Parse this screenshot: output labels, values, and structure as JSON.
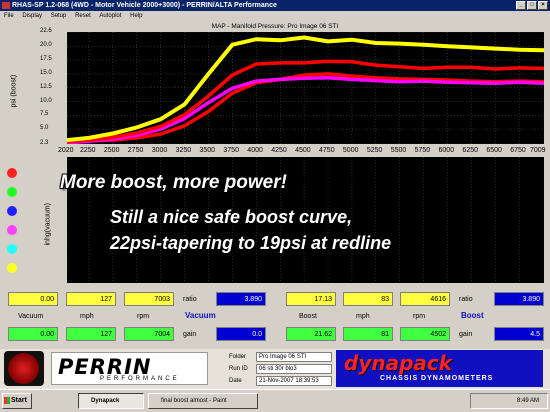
{
  "window": {
    "title": "RHAS-SP 1.2-068  (4WD - Motor Vehicle 2000+3000) - PERRIN/ALTA Performance"
  },
  "menu": [
    "File",
    "Display",
    "Setup",
    "Reset",
    "Autoplot",
    "Help"
  ],
  "chart_title": "MAP - Manifold Pressure: Pro Image 06 STI",
  "top_y_label": "psi (boost)",
  "top_y_ticks": [
    "22.6",
    "20.0",
    "17.5",
    "15.0",
    "12.5",
    "10.0",
    "7.5",
    "5.0",
    "2.3"
  ],
  "bottom_y_label": "inhg(vacuum)",
  "x_ticks": [
    "2020",
    "2250",
    "2500",
    "2750",
    "3000",
    "3250",
    "3500",
    "3750",
    "4000",
    "4250",
    "4500",
    "4750",
    "5000",
    "5250",
    "5500",
    "5750",
    "6000",
    "6250",
    "6500",
    "6750",
    "7009"
  ],
  "chart_data": {
    "type": "line",
    "title": "MAP - Manifold Pressure: Pro Image 06 STI",
    "xlabel": "",
    "ylabel": "psi (boost)",
    "xlim": [
      2020,
      7009
    ],
    "ylim": [
      2.3,
      22.6
    ],
    "x": [
      2020,
      2250,
      2500,
      2750,
      3000,
      3250,
      3500,
      3750,
      4000,
      4250,
      4500,
      4750,
      5000,
      5250,
      5500,
      5750,
      6000,
      6250,
      6500,
      6750,
      7009
    ],
    "series": [
      {
        "color": "#ffff00",
        "values": [
          3.0,
          3.4,
          4.2,
          5.3,
          6.8,
          9.5,
          15.0,
          20.3,
          21.3,
          21.1,
          21.6,
          20.9,
          21.2,
          20.6,
          20.5,
          20.3,
          20.0,
          19.8,
          19.6,
          19.4,
          19.3
        ]
      },
      {
        "color": "#ff0000",
        "values": [
          2.7,
          3.0,
          3.5,
          4.3,
          5.5,
          7.6,
          11.0,
          14.8,
          16.8,
          17.0,
          17.0,
          17.3,
          17.2,
          16.6,
          16.3,
          16.0,
          16.2,
          16.2,
          15.9,
          16.1,
          16.0
        ]
      },
      {
        "color": "#ff00ff",
        "values": [
          2.5,
          2.8,
          3.2,
          3.9,
          5.0,
          6.9,
          9.8,
          12.4,
          13.7,
          14.0,
          14.2,
          14.3,
          14.0,
          13.8,
          13.6,
          13.7,
          13.5,
          13.4,
          13.3,
          13.5,
          13.3
        ]
      },
      {
        "color": "#ff0000",
        "values": [
          2.8,
          2.9,
          3.0,
          3.4,
          4.1,
          5.6,
          8.2,
          11.5,
          13.4,
          14.0,
          14.8,
          15.0,
          14.6,
          14.3,
          14.1,
          14.0,
          13.9,
          13.7,
          13.6,
          13.7,
          13.6
        ]
      }
    ]
  },
  "legend_dots": [
    "#ff2020",
    "#20ff20",
    "#2020ff",
    "#ff40ff",
    "#20ffff",
    "#ffff20"
  ],
  "overlay": {
    "line1": "More boost, more power!",
    "line2": "Still a nice safe boost curve,",
    "line3": "22psi-tapering to 19psi at redline"
  },
  "gauges": {
    "left": {
      "row1": [
        "0.00",
        "127",
        "7003"
      ],
      "row1_labels": [
        "Vacuum",
        "mph",
        "rpm"
      ],
      "row2": [
        "0.00",
        "127",
        "7004"
      ],
      "ratio_label": "ratio",
      "ratio": "3.890",
      "gain_label": "gain",
      "gain": "0.0",
      "section": "Vacuum"
    },
    "right": {
      "row1": [
        "17.13",
        "83",
        "4616"
      ],
      "row1_labels": [
        "Boost",
        "mph",
        "rpm"
      ],
      "row2": [
        "21.62",
        "81",
        "4502"
      ],
      "ratio_label": "ratio",
      "ratio": "3.890",
      "gain_label": "gain",
      "gain": "4.5",
      "section": "Boost"
    }
  },
  "info": {
    "folder_label": "Folder",
    "folder": "Pro Image 06 STI",
    "run_label": "Run ID",
    "run": "06 sti 30r blo3",
    "date_label": "Date",
    "date": "21-Nov-2007   18:39:53"
  },
  "logos": {
    "perrin": "PERRIN",
    "perrin_sub": "PERFORMANCE",
    "dynapack": "dynapack",
    "dynapack_sub": "CHASSIS DYNAMOMETERS"
  },
  "taskbar": {
    "start": "Start",
    "tasks": [
      "Dynapack",
      "final boost almost - Paint"
    ],
    "clock": "8:49 AM"
  }
}
